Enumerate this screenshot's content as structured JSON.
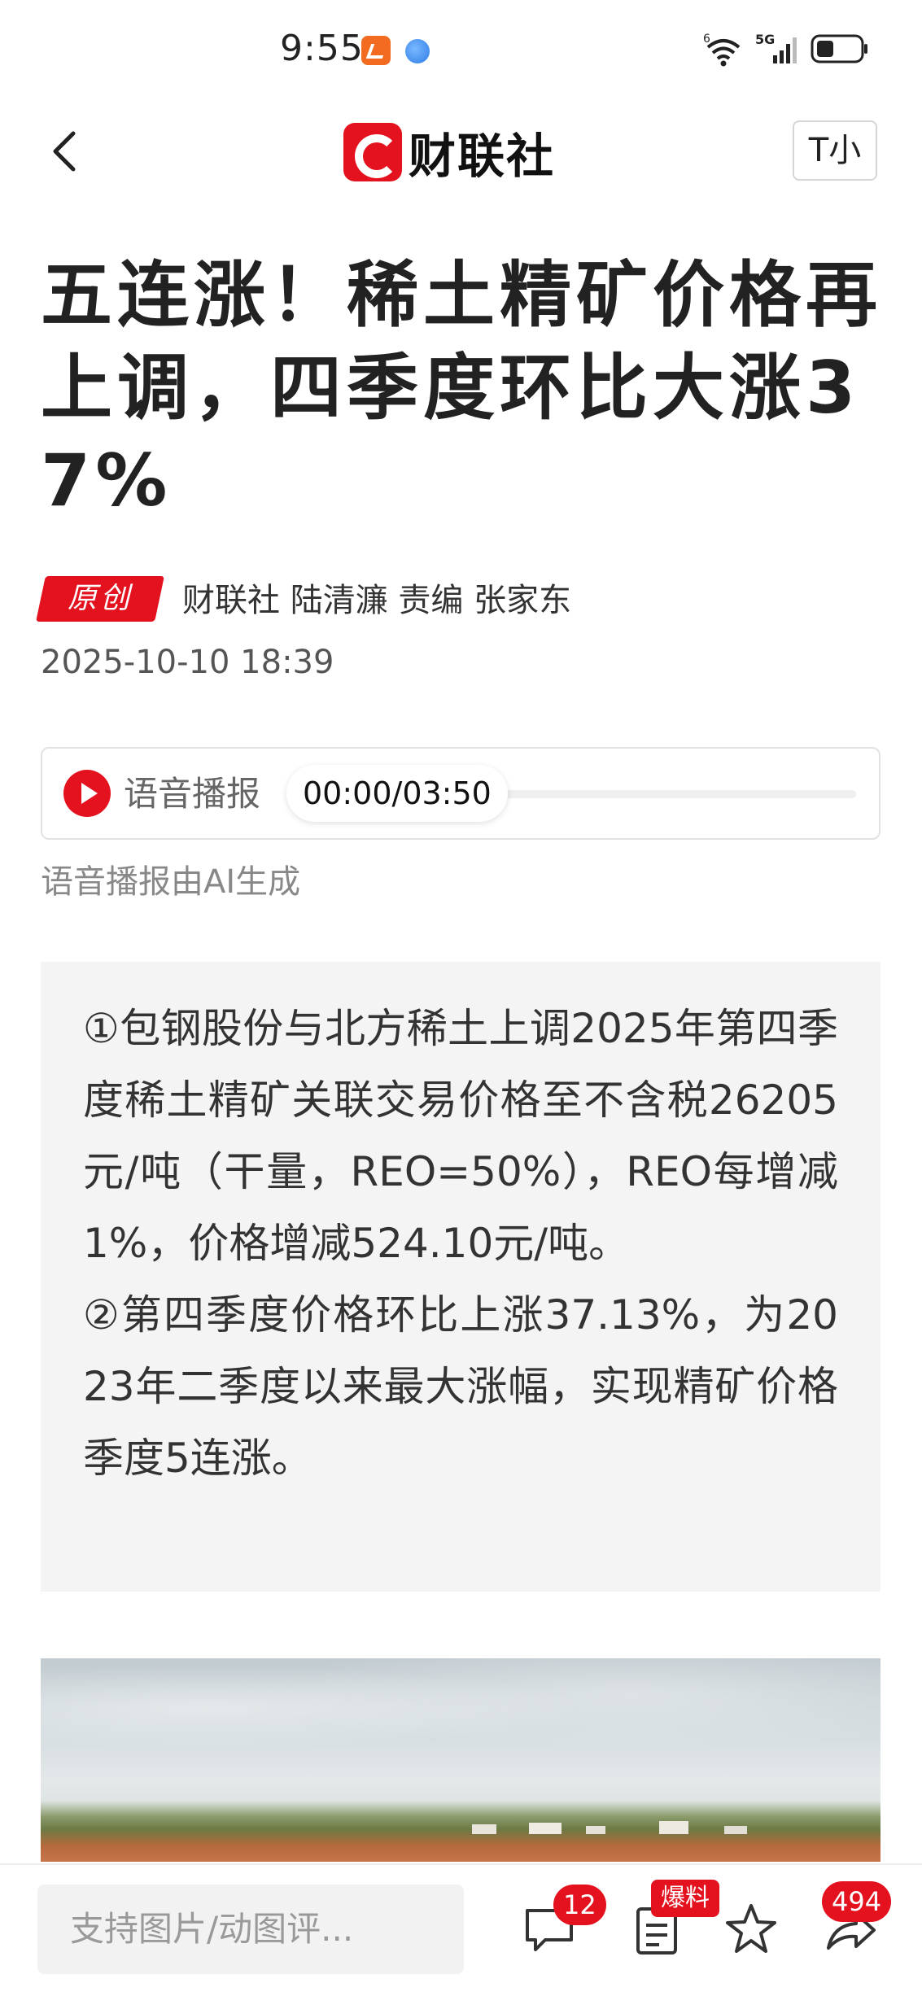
{
  "status_bar": {
    "time": "9:55",
    "network": "5G",
    "wifi_label": "6"
  },
  "header": {
    "back_icon": "chevron-left-icon",
    "brand": "财联社",
    "font_size_button": "T小"
  },
  "article": {
    "title": "五连涨！稀土精矿价格再上调，四季度环比大涨37%",
    "badge": "原创",
    "authors": "财联社 陆清濂  责编 张家东",
    "date": "2025-10-10 18:39",
    "audio": {
      "label": "语音播报",
      "time": "00:00/03:50",
      "progress": 0
    },
    "ai_note": "语音播报由AI生成",
    "summary": [
      "①包钢股份与北方稀土上调2025年第四季度稀土精矿关联交易价格至不含税26205元/吨（干量，REO=50%），REO每增减1%，价格增减524.10元/吨。",
      "②第四季度价格环比上涨37.13%，为2023年二季度以来最大涨幅，实现精矿价格季度5连涨。"
    ]
  },
  "bottom_bar": {
    "comment_placeholder": "支持图片/动图评...",
    "comment_count": "12",
    "report_label": "爆料",
    "share_count": "494"
  },
  "colors": {
    "brand_red": "#e3121e",
    "summary_bg": "#f4f4f4"
  }
}
